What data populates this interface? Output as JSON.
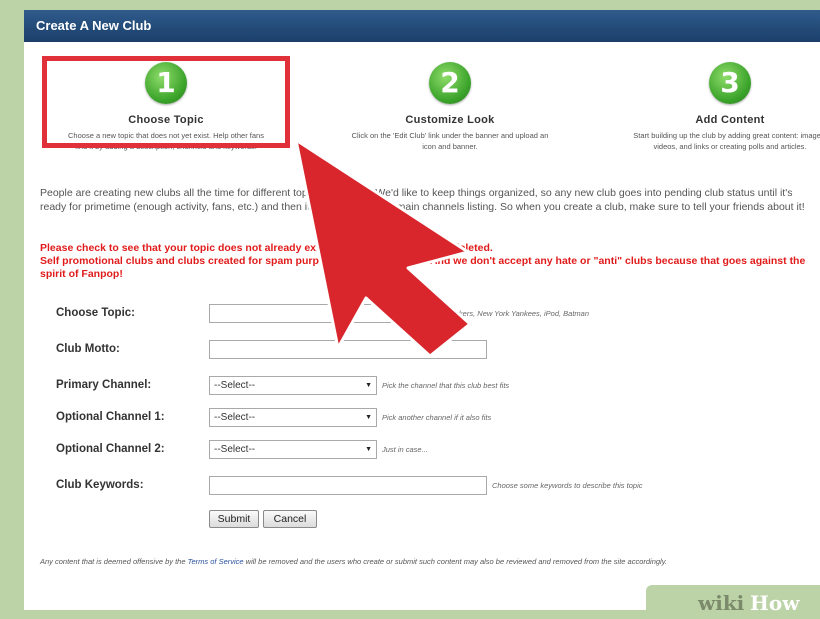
{
  "window": {
    "title": "Create A New Club"
  },
  "steps": [
    {
      "number": "1",
      "title": "Choose Topic",
      "description": "Choose a new topic that does not yet exist. Help other fans find it by adding a description, channels and keywords."
    },
    {
      "number": "2",
      "title": "Customize Look",
      "description": "Click on the 'Edit Club' link under the banner and upload an icon and banner."
    },
    {
      "number": "3",
      "title": "Add Content",
      "description": "Start building up the club by adding great content: images, videos, and links or creating polls and articles."
    }
  ],
  "intro": "People are creating new clubs all the time for different topics of interest. We'd like to keep things organized, so any new club goes into pending club status until it's ready for primetime (enough activity, fans, etc.) and then it's promoted to the main channels listing. So when you create a club, make sure to tell your friends about it!",
  "warning": {
    "line1": "Please check to see that your topic does not already exist. Duplicate topics will be deleted.",
    "line2": "Self promotional clubs and clubs created for spam purposes will be removed. And we don't accept any hate or \"anti\" clubs because that goes against the spirit of Fanpop!"
  },
  "form": {
    "topic": {
      "label": "Choose Topic:",
      "value": "",
      "hint": "e.g. Lakers, New York Yankees, iPod, Batman"
    },
    "motto": {
      "label": "Club Motto:",
      "value": ""
    },
    "primary": {
      "label": "Primary Channel:",
      "selected": "--Select--",
      "hint": "Pick the channel that this club best fits"
    },
    "optional1": {
      "label": "Optional Channel 1:",
      "selected": "--Select--",
      "hint": "Pick another channel if it also fits"
    },
    "optional2": {
      "label": "Optional Channel 2:",
      "selected": "--Select--",
      "hint": "Just in case..."
    },
    "keywords": {
      "label": "Club Keywords:",
      "value": "",
      "hint": "Choose some keywords to describe this topic"
    },
    "submit_label": "Submit",
    "cancel_label": "Cancel"
  },
  "footer": {
    "before": "Any content that is deemed offensive by the ",
    "tos_link": "Terms of Service",
    "after": " will be removed and the users who create or submit such content may also be reviewed and removed from the site accordingly."
  },
  "watermark": {
    "wiki": "wiki",
    "how": "How"
  },
  "colors": {
    "accent": "#3aa22a",
    "highlight": "#e0303a",
    "warning": "#e11b1b",
    "titlebar": "#1b3f6a"
  }
}
